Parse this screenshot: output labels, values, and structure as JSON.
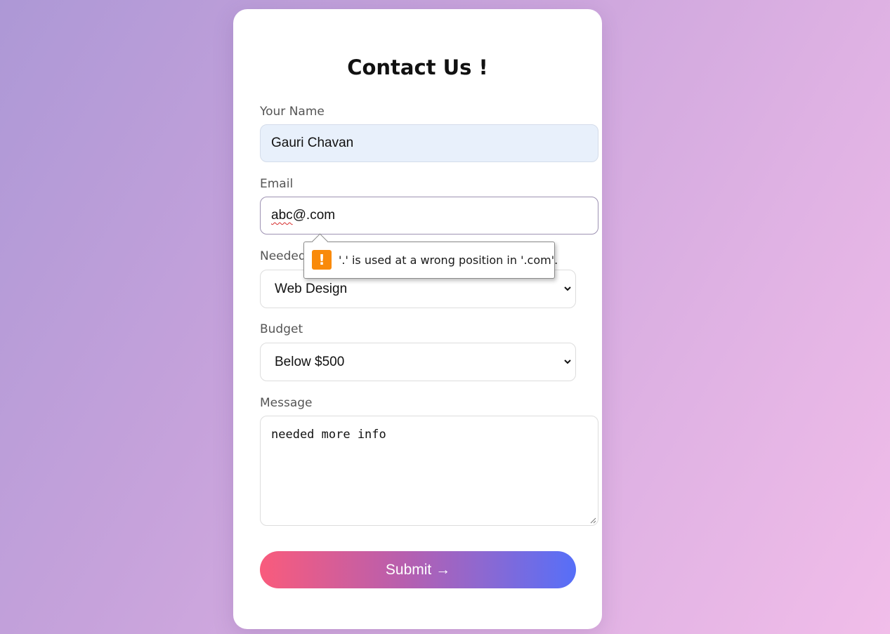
{
  "form": {
    "title": "Contact Us !",
    "name_label": "Your Name",
    "name_value": "Gauri Chavan",
    "email_label": "Email",
    "email_value_misspelled": "abc",
    "email_value_rest": "@.com",
    "service_label": "Needed",
    "service_value": "Web Design",
    "budget_label": "Budget",
    "budget_value": "Below $500",
    "message_label": "Message",
    "message_value": "needed more info",
    "submit_label": "Submit →"
  },
  "validation": {
    "icon": "warning-icon",
    "message": "'.' is used at a wrong position in '.com'."
  },
  "colors": {
    "warning": "#f98a0a",
    "submit_start": "#f95b7c",
    "submit_end": "#566ff8"
  }
}
